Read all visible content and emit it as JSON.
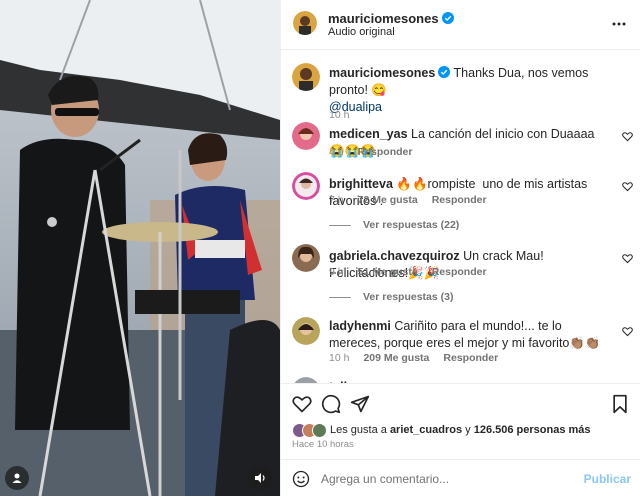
{
  "colors": {
    "accent": "#0095f6",
    "post_disabled": "#8cc6f4",
    "muted": "#8e8e8e",
    "verified": "#0095f6"
  },
  "header": {
    "username": "mauriciomesones",
    "audio": "Audio original",
    "more_icon": "more-icon"
  },
  "caption": {
    "username": "mauriciomesones",
    "text": "Thanks Dua, nos vemos pronto! 😋",
    "mention": "@dualipa",
    "time": "10 h"
  },
  "comments": [
    {
      "username": "medicen_yas",
      "text": "La canción del inicio con Duaaaa😭😭😭",
      "time": "4 h",
      "likes": "",
      "reply": "Responder",
      "view_replies": ""
    },
    {
      "username": "brighitteva",
      "text": "🔥🔥rompiste 󠀠 uno de mis artistas favoritos .",
      "time": "7 h",
      "likes": "72 Me gusta",
      "reply": "Responder",
      "view_replies": "Ver respuestas (22)"
    },
    {
      "username": "gabriela.chavezquiroz",
      "text": "Un crack Mau! Felicitaciones!🎉🎉",
      "time": "9 h",
      "likes": "51 Me gusta",
      "reply": "Responder",
      "view_replies": "Ver respuestas (3)"
    },
    {
      "username": "ladyhenmi",
      "text": "Cariñito para el mundo!... te lo mereces, porque eres el mejor y mi favorito👏🏽👏🏽",
      "time": "10 h",
      "likes": "209 Me gusta",
      "reply": "Responder",
      "view_replies": ""
    },
    {
      "username": "talle",
      "text": "…",
      "time": "",
      "likes": "",
      "reply": "",
      "view_replies": ""
    }
  ],
  "likes": {
    "prefix": "Les gusta a",
    "user": "ariet_cuadros",
    "middle": "y",
    "count": "126.506 personas más"
  },
  "post_time": "Hace 10 horas",
  "composer": {
    "placeholder": "Agrega un comentario...",
    "post_label": "Publicar"
  },
  "icons": [
    "heart-icon",
    "comment-icon",
    "share-icon",
    "bookmark-icon",
    "emoji-icon",
    "user-tag-icon",
    "sound-icon",
    "verified-icon"
  ]
}
